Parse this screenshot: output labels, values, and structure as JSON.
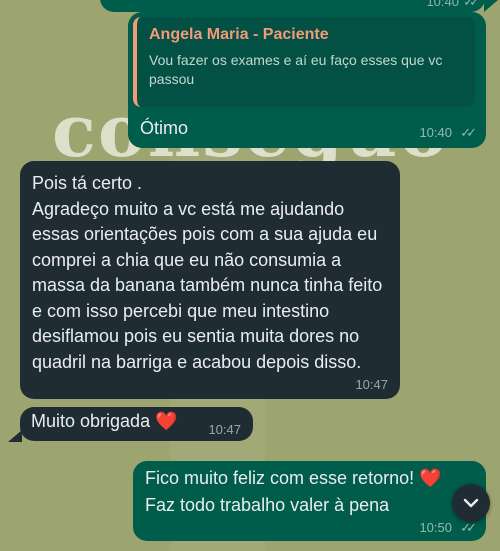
{
  "background": {
    "decorative_word": "conseguo",
    "color": "#9ca56f"
  },
  "messages": [
    {
      "direction": "out",
      "time": "10:40",
      "status": "read",
      "quote": {
        "author": "Angela Maria - Paciente",
        "text": "Vou fazer os exames e aí eu faço esses que vc passou"
      },
      "text": "Ótimo"
    },
    {
      "direction": "in",
      "time": "10:47",
      "text": "Pois tá certo .\nAgradeço muito a vc está me ajudando essas orientações pois com a sua ajuda eu comprei a chia que eu não consumia a massa da banana também nunca tinha feito e com isso percebi que meu intestino desiflamou pois eu sentia muita dores no quadril na barriga e acabou depois disso."
    },
    {
      "direction": "in",
      "time": "10:47",
      "text": "Muito obrigada",
      "emoji": "❤️"
    },
    {
      "direction": "out",
      "time": "10:50",
      "status": "read",
      "text": "Fico muito feliz com esse retorno!",
      "emoji": "❤️",
      "text_line2": "Faz todo trabalho valer à pena"
    }
  ],
  "previous_message": {
    "time": "10:40"
  },
  "icons": {
    "read_receipt": "double-check-icon",
    "scroll_down": "chevron-down-icon"
  },
  "colors": {
    "outgoing_bubble": "#005c4b",
    "incoming_bubble": "#202c33",
    "quote_accent": "#f59979"
  }
}
